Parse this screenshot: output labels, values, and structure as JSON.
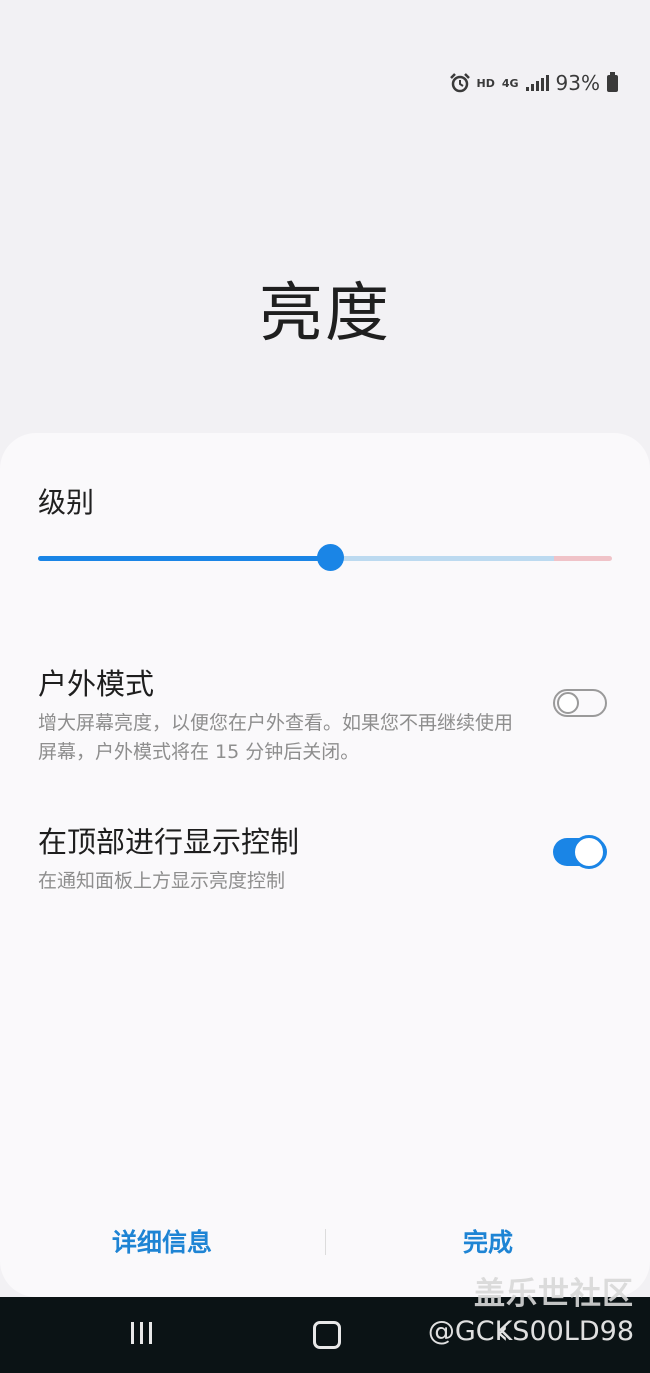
{
  "status_bar": {
    "hd_label": "HD",
    "network_label": "4G",
    "battery_text": "93%"
  },
  "page": {
    "title": "亮度"
  },
  "brightness": {
    "label": "级别",
    "level": 0.51
  },
  "settings": [
    {
      "title": "户外模式",
      "description": "增大屏幕亮度，以便您在户外查看。如果您不再继续使用屏幕，户外模式将在 15 分钟后关闭。",
      "enabled": false
    },
    {
      "title": "在顶部进行显示控制",
      "description": "在通知面板上方显示亮度控制",
      "enabled": true
    }
  ],
  "footer": {
    "details_label": "详细信息",
    "done_label": "完成"
  },
  "watermark": {
    "site": "盖乐世社区",
    "user": "@GCKS00LD98"
  },
  "colors": {
    "accent": "#1a85e6",
    "panel_bg": "#faf9fb",
    "page_bg": "#f2f1f4"
  }
}
